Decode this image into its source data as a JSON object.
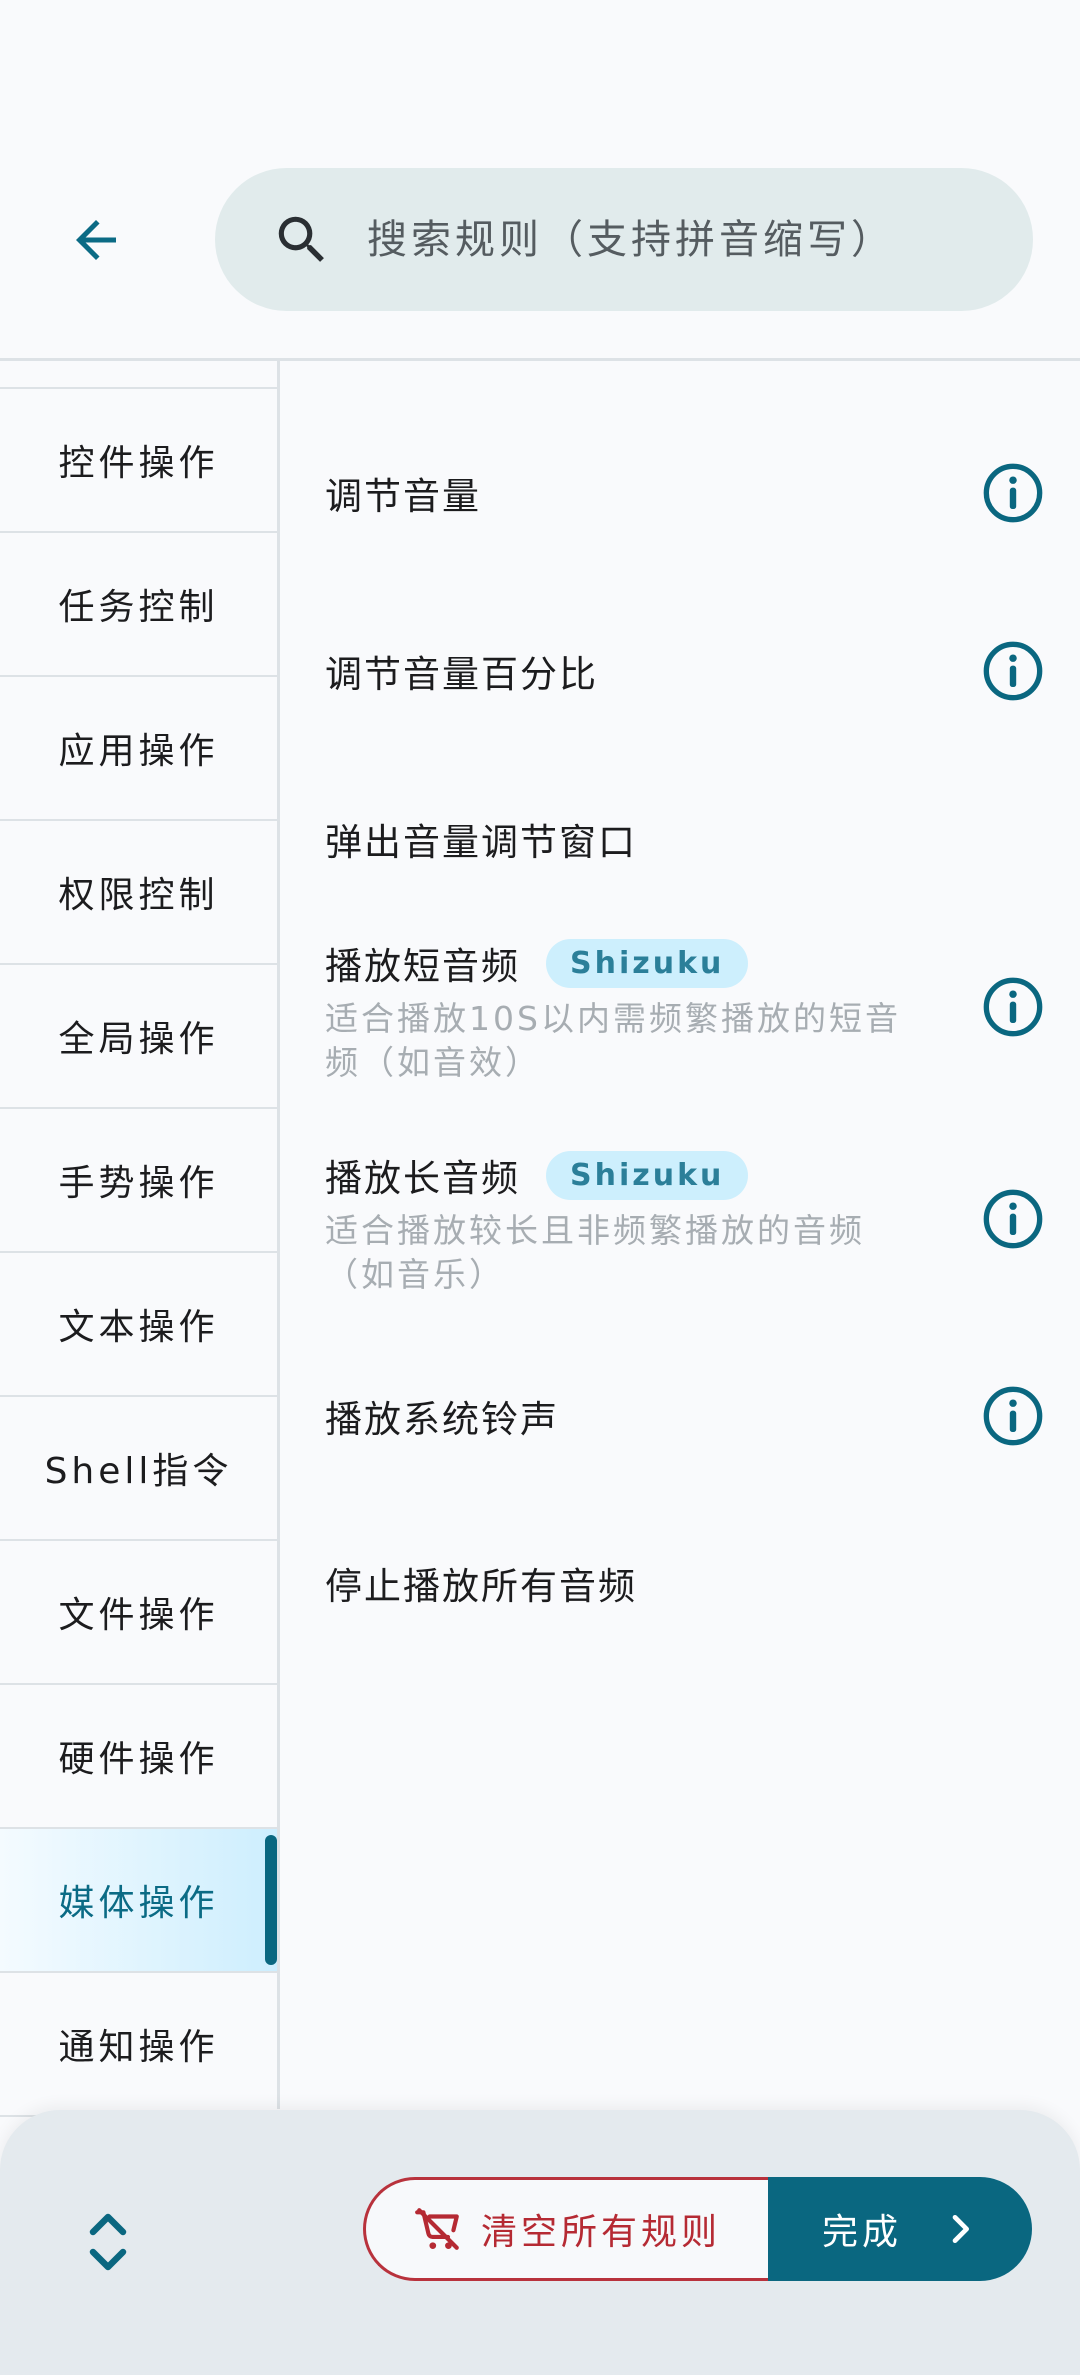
{
  "header": {
    "search_placeholder": "搜索规则（支持拼音缩写）"
  },
  "sidebar": {
    "items": [
      {
        "label": "控件操作"
      },
      {
        "label": "任务控制"
      },
      {
        "label": "应用操作"
      },
      {
        "label": "权限控制"
      },
      {
        "label": "全局操作"
      },
      {
        "label": "手势操作"
      },
      {
        "label": "文本操作"
      },
      {
        "label": "Shell指令"
      },
      {
        "label": "文件操作"
      },
      {
        "label": "硬件操作"
      },
      {
        "label": "媒体操作"
      },
      {
        "label": "通知操作"
      }
    ],
    "active": "媒体操作"
  },
  "rules": [
    {
      "title": "调节音量",
      "info": true
    },
    {
      "title": "调节音量百分比",
      "info": true
    },
    {
      "title": "弹出音量调节窗口",
      "info": false
    },
    {
      "title": "播放短音频",
      "badge": "Shizuku",
      "desc": "适合播放10S以内需频繁播放的短音频（如音效）",
      "info": true
    },
    {
      "title": "播放长音频",
      "badge": "Shizuku",
      "desc": "适合播放较长且非频繁播放的音频（如音乐）",
      "info": true
    },
    {
      "title": "播放系统铃声",
      "info": true
    },
    {
      "title": "停止播放所有音频",
      "info": false
    }
  ],
  "bottom": {
    "clear_label": "清空所有规则",
    "done_label": "完成"
  },
  "colors": {
    "accent": "#0a6780",
    "danger": "#b52a33",
    "badge_bg": "#cdeffd",
    "search_bg": "#e1ebec"
  }
}
